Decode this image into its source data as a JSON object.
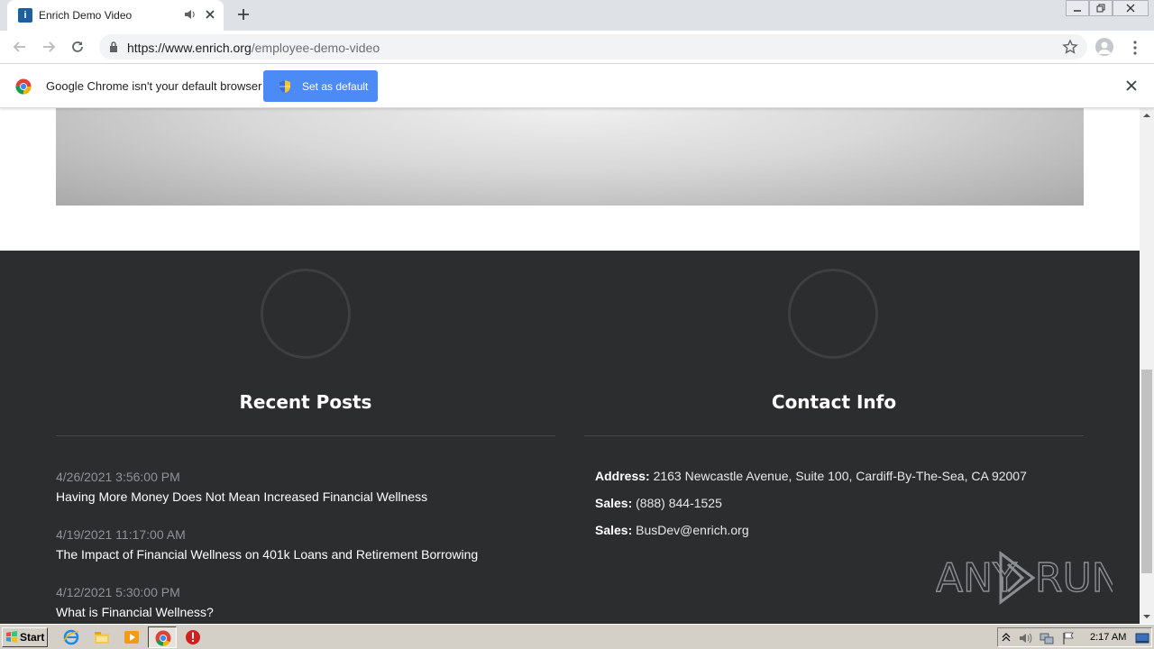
{
  "browser": {
    "tab": {
      "title": "Enrich Demo Video",
      "favicon_glyph": "i"
    },
    "url": {
      "host": "https://www.enrich.org",
      "path": "/employee-demo-video"
    },
    "infobar": {
      "message": "Google Chrome isn't your default browser",
      "button_label": "Set as default"
    }
  },
  "footer": {
    "recent_posts": {
      "heading": "Recent Posts",
      "posts": [
        {
          "date": "4/26/2021 3:56:00 PM",
          "title": "Having More Money Does Not Mean Increased Financial Wellness"
        },
        {
          "date": "4/19/2021 11:17:00 AM",
          "title": "The Impact of Financial Wellness on 401k Loans and Retirement Borrowing"
        },
        {
          "date": "4/12/2021 5:30:00 PM",
          "title": "What is Financial Wellness?"
        }
      ]
    },
    "contact_info": {
      "heading": "Contact Info",
      "lines": [
        {
          "label": "Address:",
          "value": "2163 Newcastle Avenue, Suite 100, Cardiff-By-The-Sea, CA 92007"
        },
        {
          "label": "Sales:",
          "value": "(888) 844-1525"
        },
        {
          "label": "Sales:",
          "value": "BusDev@enrich.org"
        }
      ]
    }
  },
  "watermark": {
    "left": "ANY",
    "right": "RUN"
  },
  "taskbar": {
    "start_label": "Start",
    "clock": "2:17 AM"
  },
  "colors": {
    "footer_bg": "#2b2d2f",
    "chrome_button": "#4c8bf5",
    "taskbar": "#d4d0c8"
  }
}
